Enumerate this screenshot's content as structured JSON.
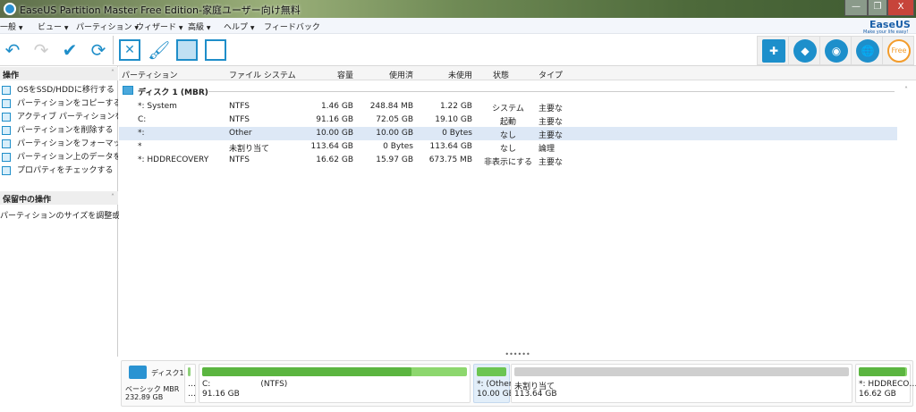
{
  "window": {
    "title": "EaseUS Partition Master Free Edition-家庭ユーザー向け無料",
    "minimize": "—",
    "restore": "❐",
    "close": "X"
  },
  "menu": [
    "一般",
    "ビュー",
    "パーティション",
    "ウィザード",
    "高級",
    "ヘルプ",
    "フィードバック"
  ],
  "menu_arrow": "▼",
  "brand": {
    "name": "EaseUS",
    "tagline": "Make your life easy!",
    "color": "#1a5fa8"
  },
  "toolbar": {
    "undo": "undo-icon",
    "redo": "redo-icon",
    "apply": "check-icon",
    "refresh": "refresh-icon",
    "delete": "delete-icon",
    "format": "brush-icon",
    "wipe": "partition-icon",
    "copy": "copy-icon",
    "free_label": "Free"
  },
  "left": {
    "ops_title": "操作",
    "ops": [
      "OSをSSD/HDDに移行する",
      "パーティションをコピーする",
      "アクティブ パーティションを設定す",
      "パーティションを削除する",
      "パーティションをフォーマットする",
      "パーティション上のデータを消去",
      "プロパティをチェックする"
    ],
    "pending_title": "保留中の操作",
    "pending": [
      "パーティションのサイズを調整或…"
    ],
    "collapse": "˄"
  },
  "table": {
    "headers": [
      "パーティション",
      "ファイル システム",
      "容量",
      "使用済",
      "未使用",
      "状態",
      "タイプ"
    ],
    "disk": "ディスク 1 (MBR)",
    "rows": [
      [
        "*: System",
        "NTFS",
        "1.46 GB",
        "248.84 MB",
        "1.22 GB",
        "システム",
        "主要な"
      ],
      [
        "C:",
        "NTFS",
        "91.16 GB",
        "72.05 GB",
        "19.10 GB",
        "起動",
        "主要な"
      ],
      [
        "*:",
        "Other",
        "10.00 GB",
        "10.00 GB",
        "0 Bytes",
        "なし",
        "主要な"
      ],
      [
        "*",
        "未割り当て",
        "113.64 GB",
        "0 Bytes",
        "113.64 GB",
        "なし",
        "論理"
      ],
      [
        "*: HDDRECOVERY",
        "NTFS",
        "16.62 GB",
        "15.97 GB",
        "673.75 MB",
        "非表示にする",
        "主要な"
      ]
    ]
  },
  "splitter": "••••••",
  "diskmap": {
    "name": "ディスク1",
    "type": "ベーシック MBR",
    "size": "232.89 GB",
    "small": {
      "l1": "…",
      "l2": "…"
    },
    "c": {
      "l1": "C:",
      "fs": "(NTFS)",
      "l2": "91.16 GB",
      "used_fraction": 0.79
    },
    "other": {
      "l1": "*: (Other)",
      "l2": "10.00 GB"
    },
    "unalloc": {
      "l1": "未割り当て",
      "l2": "113.64 GB"
    },
    "hdd": {
      "l1": "*: HDDRECO…",
      "l2": "16.62 GB",
      "used_fraction": 0.96
    }
  }
}
